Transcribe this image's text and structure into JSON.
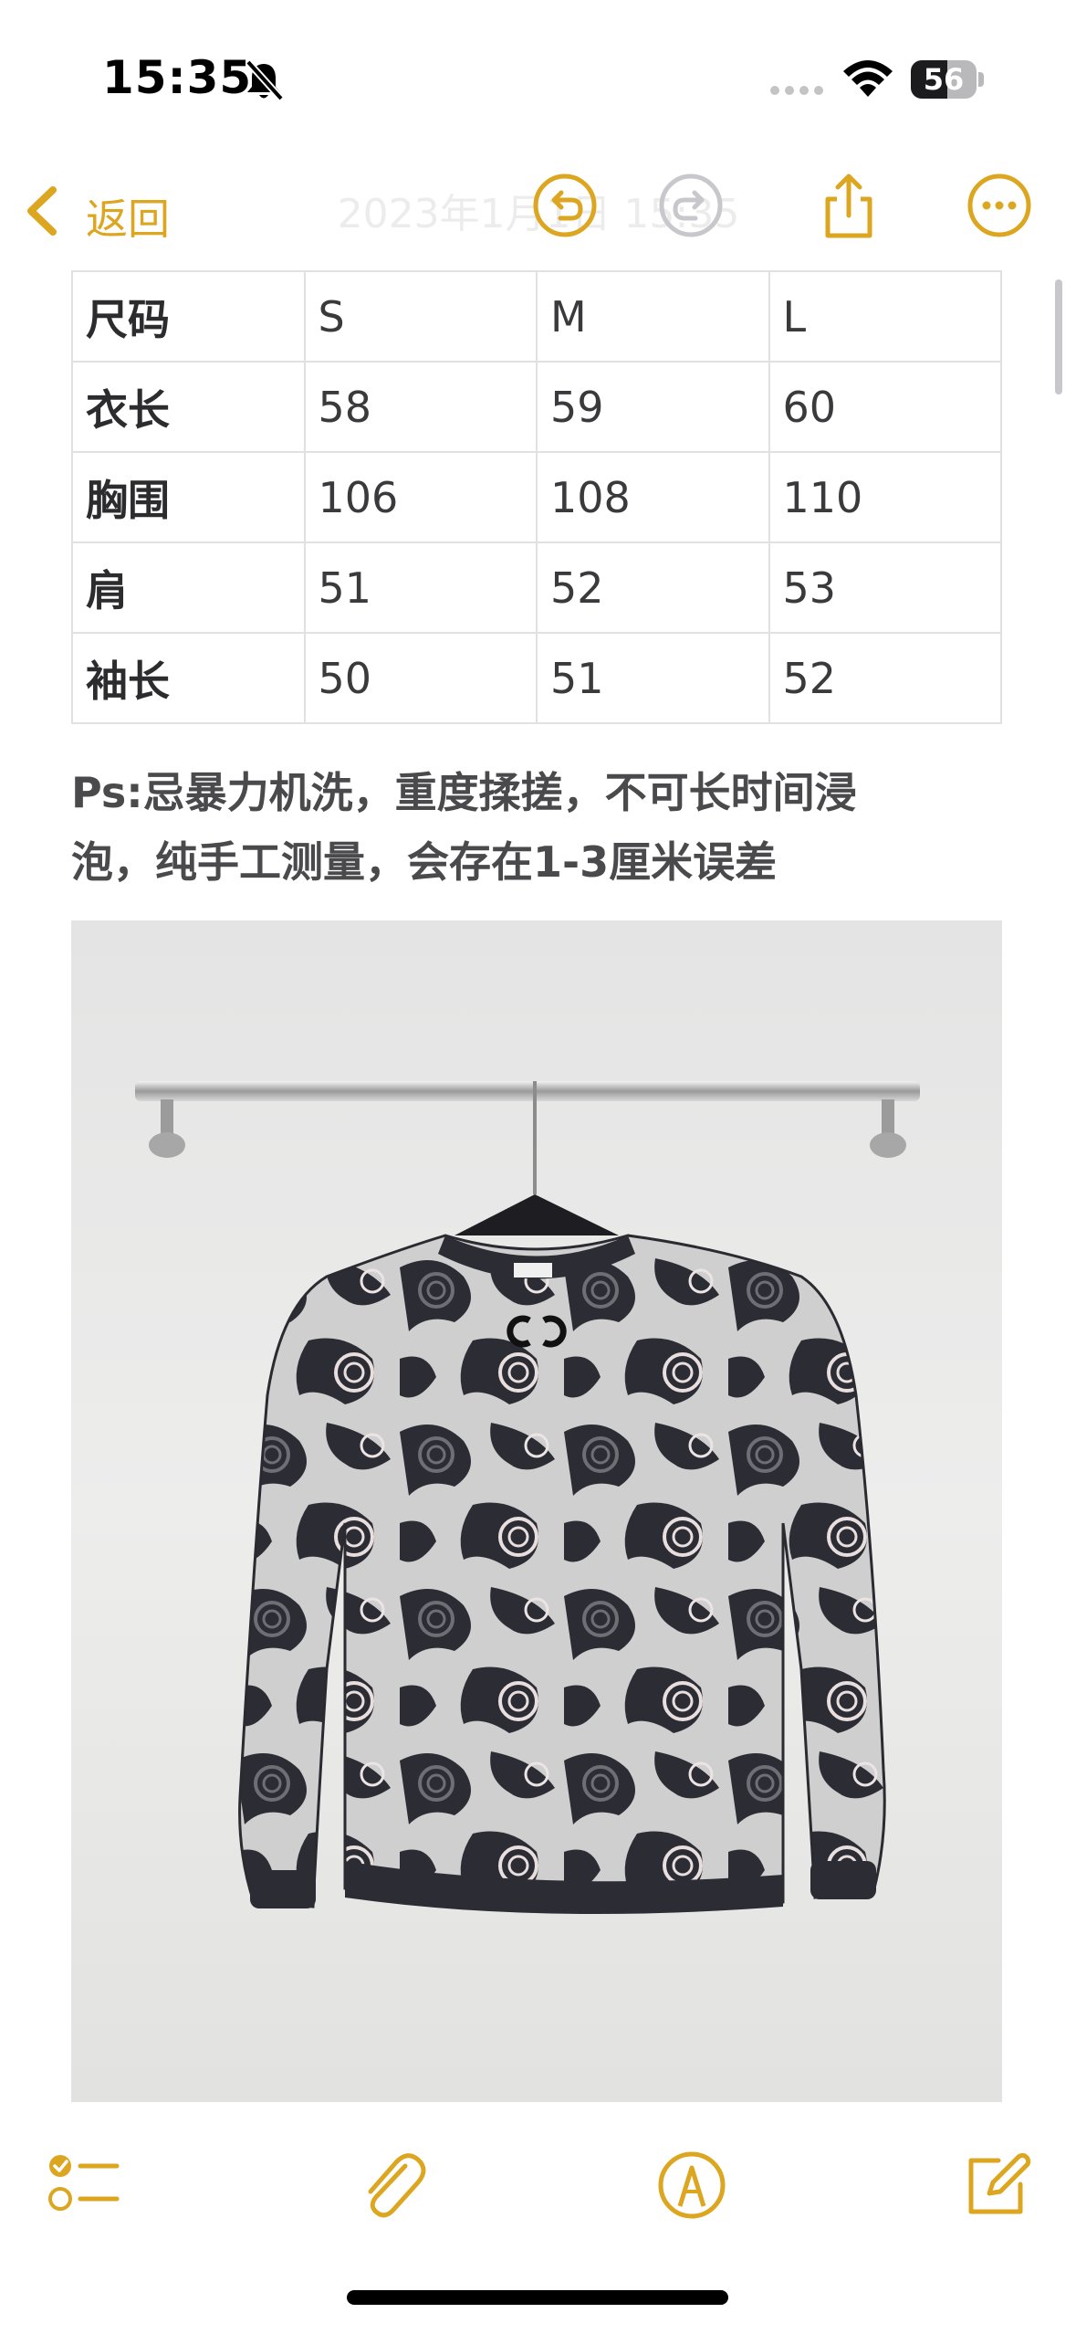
{
  "status_bar": {
    "time": "15:35",
    "battery_level": "56",
    "battery_fraction": 0.56,
    "icons": [
      "bell-slash-icon",
      "cellular-dots-icon",
      "wifi-icon",
      "battery-icon"
    ]
  },
  "nav": {
    "back_label": "返回",
    "title": "2023年1月1日 15:35",
    "icons": [
      "chevron-left-icon",
      "undo-icon",
      "redo-icon",
      "share-icon",
      "more-icon"
    ],
    "accent_color": "#dca620",
    "disabled_color": "#c7c7cc"
  },
  "size_table": {
    "rows": [
      [
        "尺码",
        "S",
        "M",
        "L"
      ],
      [
        "衣长",
        "58",
        "59",
        "60"
      ],
      [
        "胸围",
        "106",
        "108",
        "110"
      ],
      [
        "肩",
        "51",
        "52",
        "53"
      ],
      [
        "袖长",
        "50",
        "51",
        "52"
      ]
    ]
  },
  "note": {
    "line1": "Ps:忌暴力机洗，重度揉搓，不可长时间浸",
    "line2": "泡，纯手工测量，会存在1-3厘米误差"
  },
  "photo": {
    "description_icon": "sweater-photo"
  },
  "toolbar": {
    "icons": [
      "checklist-icon",
      "paperclip-icon",
      "markup-pen-icon",
      "compose-icon"
    ]
  }
}
